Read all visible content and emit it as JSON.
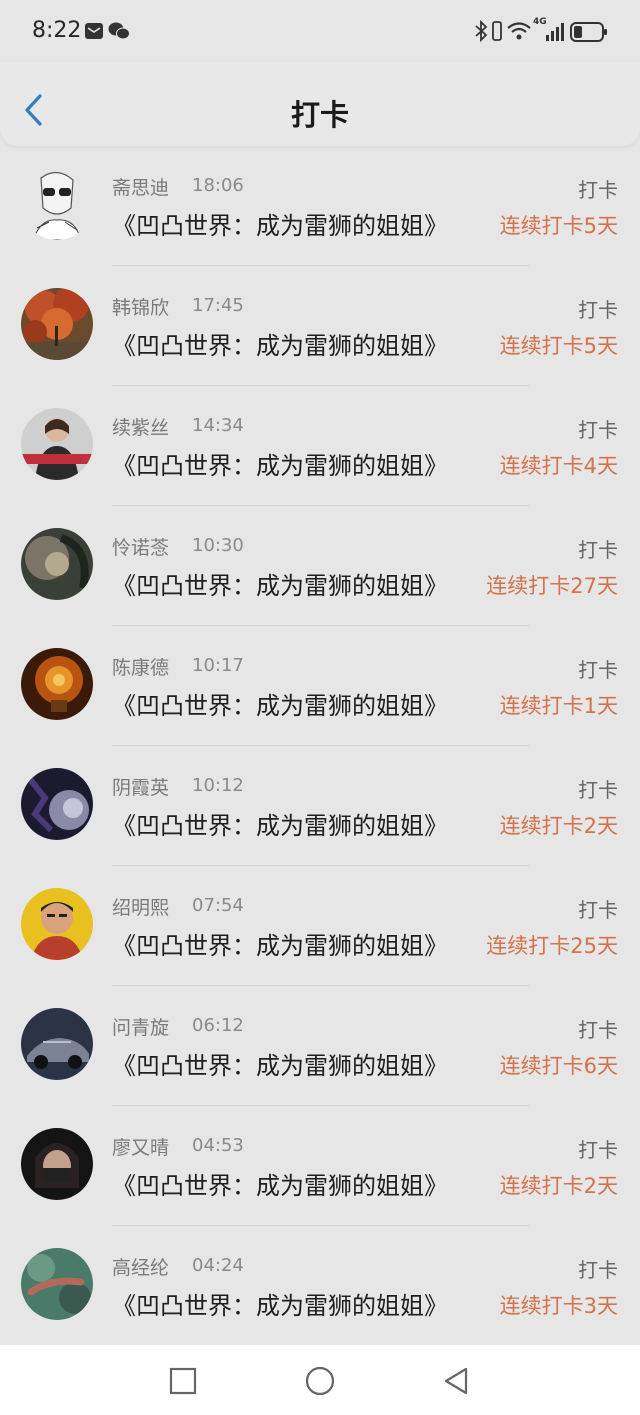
{
  "status_bar": {
    "time": "8:22",
    "network": "4G",
    "icons": [
      "mail-icon",
      "wechat-icon",
      "bluetooth-icon",
      "vibrate-icon",
      "wifi-icon",
      "signal-icon",
      "battery-icon"
    ]
  },
  "header": {
    "title": "打卡",
    "back_icon": "chevron-left-icon",
    "accent_color": "#2f7fc1"
  },
  "checkins": [
    {
      "name": "斋思迪",
      "time": "18:06",
      "book": "《凹凸世界：成为雷狮的姐姐》",
      "action": "打卡",
      "streak": "连续打卡5天"
    },
    {
      "name": "韩锦欣",
      "time": "17:45",
      "book": "《凹凸世界：成为雷狮的姐姐》",
      "action": "打卡",
      "streak": "连续打卡5天"
    },
    {
      "name": "续紫丝",
      "time": "14:34",
      "book": "《凹凸世界：成为雷狮的姐姐》",
      "action": "打卡",
      "streak": "连续打卡4天"
    },
    {
      "name": "怜诺菍",
      "time": "10:30",
      "book": "《凹凸世界：成为雷狮的姐姐》",
      "action": "打卡",
      "streak": "连续打卡27天"
    },
    {
      "name": "陈康德",
      "time": "10:17",
      "book": "《凹凸世界：成为雷狮的姐姐》",
      "action": "打卡",
      "streak": "连续打卡1天"
    },
    {
      "name": "阴霞英",
      "time": "10:12",
      "book": "《凹凸世界：成为雷狮的姐姐》",
      "action": "打卡",
      "streak": "连续打卡2天"
    },
    {
      "name": "绍明熙",
      "time": "07:54",
      "book": "《凹凸世界：成为雷狮的姐姐》",
      "action": "打卡",
      "streak": "连续打卡25天"
    },
    {
      "name": "问青旋",
      "time": "06:12",
      "book": "《凹凸世界：成为雷狮的姐姐》",
      "action": "打卡",
      "streak": "连续打卡6天"
    },
    {
      "name": "廖又晴",
      "time": "04:53",
      "book": "《凹凸世界：成为雷狮的姐姐》",
      "action": "打卡",
      "streak": "连续打卡2天"
    },
    {
      "name": "高经纶",
      "time": "04:24",
      "book": "《凹凸世界：成为雷狮的姐姐》",
      "action": "打卡",
      "streak": "连续打卡3天"
    }
  ],
  "nav_bar": {
    "icons": [
      "recent-apps-icon",
      "home-icon",
      "back-icon"
    ]
  }
}
